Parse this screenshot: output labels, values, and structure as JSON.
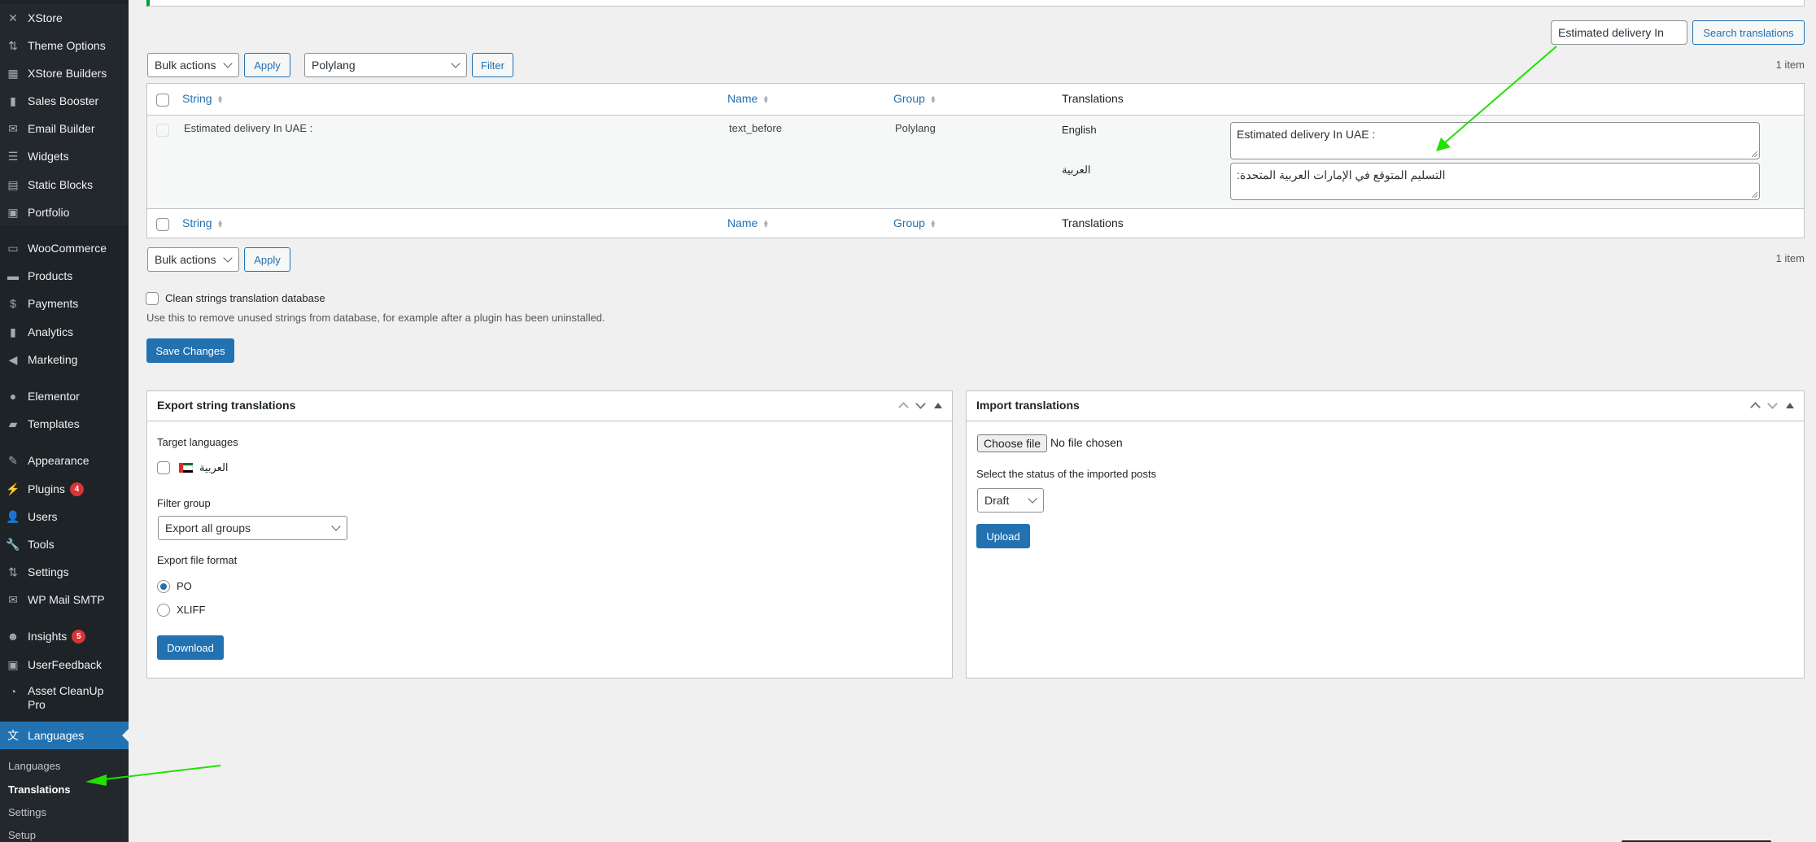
{
  "sidebar": {
    "items": [
      {
        "label": "XStore",
        "icon": "xstore-icon"
      },
      {
        "label": "Theme Options",
        "icon": "sliders-icon"
      },
      {
        "label": "XStore Builders",
        "icon": "layout-icon"
      },
      {
        "label": "Sales Booster",
        "icon": "bar-chart-icon"
      },
      {
        "label": "Email Builder",
        "icon": "envelope-icon"
      },
      {
        "label": "Widgets",
        "icon": "widgets-icon"
      },
      {
        "label": "Static Blocks",
        "icon": "blocks-icon"
      },
      {
        "label": "Portfolio",
        "icon": "portfolio-icon"
      },
      {
        "label": "WooCommerce",
        "icon": "woo-icon"
      },
      {
        "label": "Products",
        "icon": "archive-icon"
      },
      {
        "label": "Payments",
        "icon": "dollar-icon"
      },
      {
        "label": "Analytics",
        "icon": "bar-chart-icon"
      },
      {
        "label": "Marketing",
        "icon": "megaphone-icon"
      },
      {
        "label": "Elementor",
        "icon": "elementor-icon"
      },
      {
        "label": "Templates",
        "icon": "folder-icon"
      },
      {
        "label": "Appearance",
        "icon": "brush-icon"
      },
      {
        "label": "Plugins",
        "icon": "plug-icon",
        "badge": "4"
      },
      {
        "label": "Users",
        "icon": "user-icon"
      },
      {
        "label": "Tools",
        "icon": "wrench-icon"
      },
      {
        "label": "Settings",
        "icon": "sliders-icon"
      },
      {
        "label": "WP Mail SMTP",
        "icon": "mail-arrow-icon"
      },
      {
        "label": "Insights",
        "icon": "monster-icon",
        "badge": "5"
      },
      {
        "label": "UserFeedback",
        "icon": "feedback-icon"
      },
      {
        "label": "Asset CleanUp Pro",
        "icon": "gauge-icon"
      },
      {
        "label": "Languages",
        "icon": "translate-icon"
      }
    ],
    "submenu": [
      "Languages",
      "Translations",
      "Settings",
      "Setup"
    ]
  },
  "toolbar": {
    "search_value": "Estimated delivery In",
    "search_button": "Search translations",
    "bulk_actions": "Bulk actions",
    "apply": "Apply",
    "group_filter": "Polylang",
    "filter": "Filter",
    "count": "1 item"
  },
  "table": {
    "columns": [
      "String",
      "Name",
      "Group",
      "Translations"
    ],
    "rows": [
      {
        "string": "Estimated delivery In UAE :",
        "name": "text_before",
        "group": "Polylang",
        "translations": [
          {
            "lang": "English",
            "value": "Estimated delivery In UAE :"
          },
          {
            "lang": "العربية",
            "value": "التسليم المتوقع في الإمارات العربية المتحدة:"
          }
        ]
      }
    ]
  },
  "clean": {
    "label": "Clean strings translation database",
    "help": "Use this to remove unused strings from database, for example after a plugin has been uninstalled.",
    "save": "Save Changes"
  },
  "export": {
    "title": "Export string translations",
    "target_label": "Target languages",
    "target_lang": "العربية",
    "filter_label": "Filter group",
    "filter_value": "Export all groups",
    "format_label": "Export file format",
    "formats": [
      "PO",
      "XLIFF"
    ],
    "selected_format": "PO",
    "download": "Download"
  },
  "import": {
    "title": "Import translations",
    "choose_file": "Choose file",
    "no_file": "No file chosen",
    "status_label": "Select the status of the imported posts",
    "status_value": "Draft",
    "upload": "Upload"
  }
}
